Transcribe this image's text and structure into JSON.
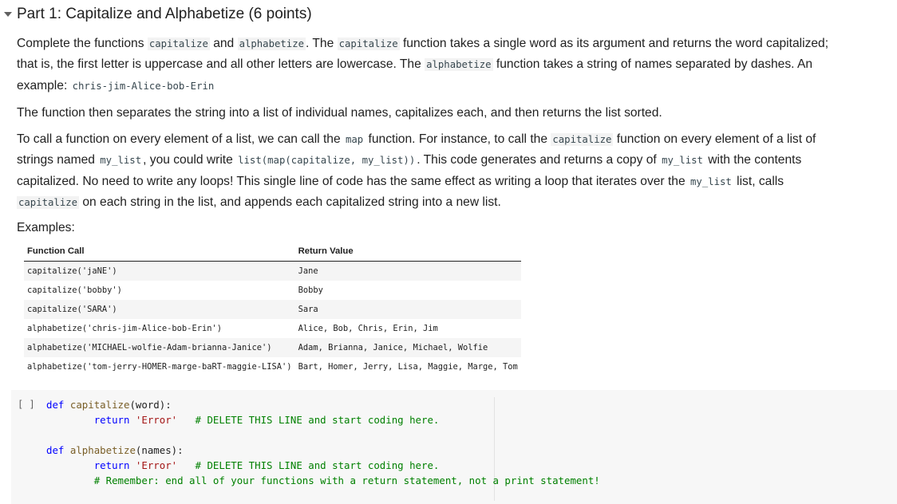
{
  "section": {
    "title": "Part 1: Capitalize and Alphabetize (6 points)",
    "caret_icon": "chevron-down-icon"
  },
  "intro": {
    "p1_a": "Complete the functions ",
    "p1_code_capitalize": "capitalize",
    "p1_b": " and ",
    "p1_code_alphabetize": "alphabetize",
    "p1_c": ". The ",
    "p1_code_capitalize2": "capitalize",
    "p1_d": " function takes a single word as its argument and returns the word capitalized; that is, the first letter is uppercase and all other letters are lowercase. The ",
    "p1_code_alphabetize2": "alphabetize",
    "p1_e": " function takes a string of names separated by dashes. An example: ",
    "p1_code_example": "chris-jim-Alice-bob-Erin",
    "p2": "The function then separates the string into a list of individual names, capitalizes each, and then returns the list sorted.",
    "p3_a": "To call a function on every element of a list, we can call the ",
    "p3_code_map": "map",
    "p3_b": " function. For instance, to call the ",
    "p3_code_capitalize": "capitalize",
    "p3_c": " function on every element of a list of strings named ",
    "p3_code_mylist": "my_list",
    "p3_d": ", you could write ",
    "p3_code_call": "list(map(capitalize, my_list))",
    "p3_e": ". This code generates and returns a copy of ",
    "p3_code_mylist2": "my_list",
    "p3_f": " with the contents capitalized. No need to write any loops! This single line of code has the same effect as writing a loop that iterates over the ",
    "p3_code_mylist3": "my_list",
    "p3_g": " list, calls ",
    "p3_code_capitalize2": "capitalize",
    "p3_h": " on each string in the list, and appends each capitalized string into a new list.",
    "examples_label": "Examples:"
  },
  "table": {
    "headers": [
      "Function Call",
      "Return Value"
    ],
    "rows": [
      [
        "capitalize('jaNE')",
        "Jane"
      ],
      [
        "capitalize('bobby')",
        "Bobby"
      ],
      [
        "capitalize('SARA')",
        "Sara"
      ],
      [
        "alphabetize('chris-jim-Alice-bob-Erin')",
        "Alice, Bob, Chris, Erin, Jim"
      ],
      [
        "alphabetize('MICHAEL-wolfie-Adam-brianna-Janice')",
        "Adam, Brianna, Janice, Michael, Wolfie"
      ],
      [
        "alphabetize('tom-jerry-HOMER-marge-baRT-maggie-LISA')",
        "Bart, Homer, Jerry, Lisa, Maggie, Marge, Tom"
      ]
    ]
  },
  "code_cell": {
    "run_label": "[ ]",
    "lines": {
      "l1_def": "def",
      "l1_name": "capitalize",
      "l1_args": "(word):",
      "l2_return": "return",
      "l2_str": "'Error'",
      "l2_comment": "# DELETE THIS LINE and start coding here.",
      "l4_def": "def",
      "l4_name": "alphabetize",
      "l4_args": "(names):",
      "l5_return": "return",
      "l5_str": "'Error'",
      "l5_comment": "# DELETE THIS LINE and start coding here.",
      "l6_comment": "# Remember: end all of your functions with a return statement, not a print statement!"
    }
  }
}
